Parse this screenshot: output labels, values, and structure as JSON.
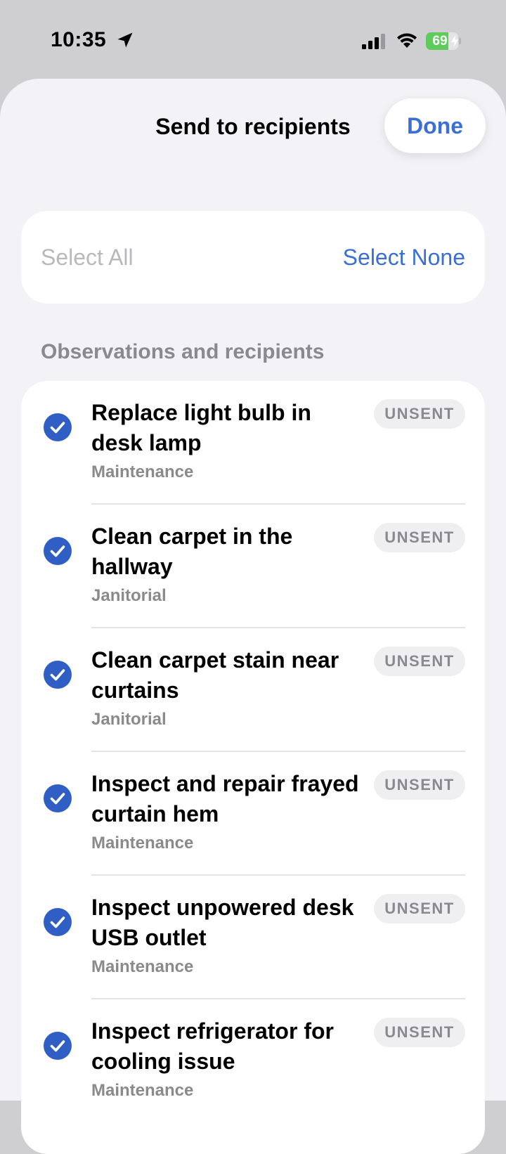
{
  "status_bar": {
    "time": "10:35",
    "battery_level": "69",
    "battery_fraction": 0.69,
    "icons": [
      "location-arrow-icon",
      "cellular-signal-icon",
      "wifi-icon",
      "battery-icon",
      "charging-bolt-icon"
    ]
  },
  "sheet": {
    "title": "Send to recipients",
    "done_label": "Done"
  },
  "selection": {
    "select_all_label": "Select All",
    "select_none_label": "Select None"
  },
  "section": {
    "header": "Observations and recipients"
  },
  "observations": [
    {
      "title": "Replace light bulb in desk lamp",
      "category": "Maintenance",
      "status": "UNSENT",
      "checked": true
    },
    {
      "title": "Clean carpet in the hallway",
      "category": "Janitorial",
      "status": "UNSENT",
      "checked": true
    },
    {
      "title": "Clean carpet stain near curtains",
      "category": "Janitorial",
      "status": "UNSENT",
      "checked": true
    },
    {
      "title": "Inspect and repair frayed curtain hem",
      "category": "Maintenance",
      "status": "UNSENT",
      "checked": true
    },
    {
      "title": "Inspect unpowered desk USB outlet",
      "category": "Maintenance",
      "status": "UNSENT",
      "checked": true
    },
    {
      "title": "Inspect refrigerator for cooling issue",
      "category": "Maintenance",
      "status": "UNSENT",
      "checked": true
    }
  ],
  "colors": {
    "accent": "#3b6fd6",
    "check": "#2f5ec4",
    "battery_green": "#5fcb5a",
    "secondary_text": "#8a8a8e"
  }
}
